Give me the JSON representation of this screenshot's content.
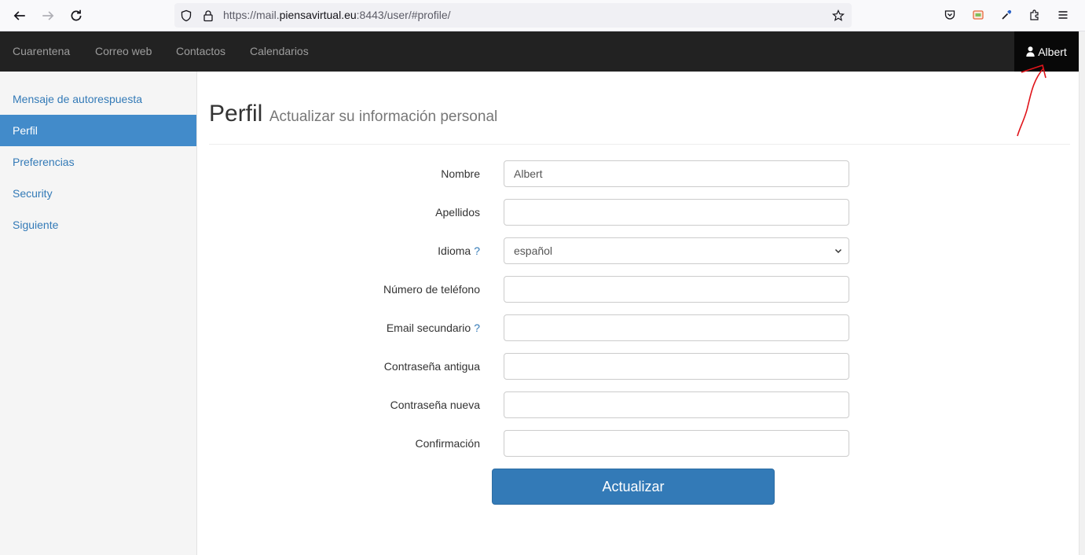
{
  "browser": {
    "url_prefix": "https://mail.",
    "url_domain": "piensavirtual.eu",
    "url_suffix": ":8443/user/#profile/"
  },
  "topnav": {
    "items": [
      "Cuarentena",
      "Correo web",
      "Contactos",
      "Calendarios"
    ],
    "user": "Albert"
  },
  "sidebar": {
    "items": [
      {
        "label": "Mensaje de autorespuesta",
        "active": false
      },
      {
        "label": "Perfil",
        "active": true
      },
      {
        "label": "Preferencias",
        "active": false
      },
      {
        "label": "Security",
        "active": false
      },
      {
        "label": "Siguiente",
        "active": false
      }
    ]
  },
  "page": {
    "title": "Perfil",
    "subtitle": "Actualizar su información personal"
  },
  "form": {
    "fields": [
      {
        "label": "Nombre",
        "value": "Albert",
        "help": ""
      },
      {
        "label": "Apellidos",
        "value": "",
        "help": ""
      },
      {
        "label": "Idioma",
        "value": "español",
        "help": "?"
      },
      {
        "label": "Número de teléfono",
        "value": "",
        "help": ""
      },
      {
        "label": "Email secundario",
        "value": "",
        "help": "?"
      },
      {
        "label": "Contraseña antigua",
        "value": "",
        "help": ""
      },
      {
        "label": "Contraseña nueva",
        "value": "",
        "help": ""
      },
      {
        "label": "Confirmación",
        "value": "",
        "help": ""
      }
    ],
    "submit_label": "Actualizar"
  },
  "icons": {
    "back": "arrow-left-icon",
    "forward": "arrow-right-icon",
    "reload": "reload-icon",
    "shield": "shield-icon",
    "lock": "lock-icon",
    "bookmark": "star-icon",
    "pocket": "pocket-icon",
    "extensions": "puzzle-icon",
    "menu": "hamburger-icon",
    "user": "user-icon"
  },
  "colors": {
    "nav_bg": "#222222",
    "active_sidebar": "#428bca",
    "link": "#337ab7",
    "button": "#337ab7"
  }
}
